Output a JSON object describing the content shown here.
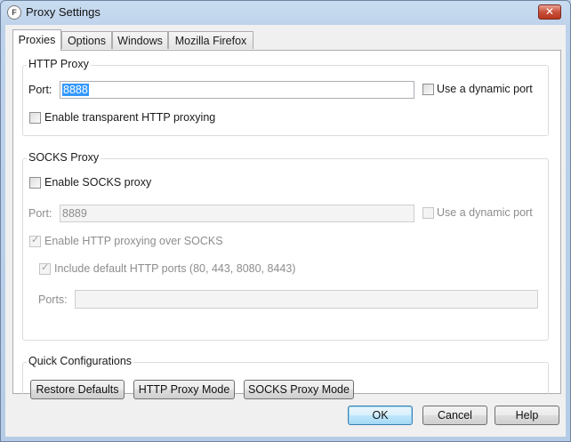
{
  "window": {
    "title": "Proxy Settings",
    "app_icon": "fiddler-icon",
    "close_glyph": "✕"
  },
  "tabs": [
    {
      "label": "Proxies"
    },
    {
      "label": "Options"
    },
    {
      "label": "Windows"
    },
    {
      "label": "Mozilla Firefox"
    }
  ],
  "http_proxy": {
    "title": "HTTP Proxy",
    "port_label": "Port:",
    "port_value": "8888",
    "dynamic_port_label": "Use a dynamic port",
    "transparent_label": "Enable transparent HTTP proxying"
  },
  "socks_proxy": {
    "title": "SOCKS Proxy",
    "enable_label": "Enable SOCKS proxy",
    "port_label": "Port:",
    "port_value": "8889",
    "dynamic_port_label": "Use a dynamic port",
    "http_over_socks_label": "Enable HTTP proxying over SOCKS",
    "include_ports_label": "Include default HTTP ports (80, 443, 8080, 8443)",
    "ports_label": "Ports:",
    "ports_value": ""
  },
  "quick": {
    "title": "Quick Configurations",
    "restore_label": "Restore Defaults",
    "http_mode_label": "HTTP Proxy Mode",
    "socks_mode_label": "SOCKS Proxy Mode"
  },
  "footer": {
    "ok_label": "OK",
    "cancel_label": "Cancel",
    "help_label": "Help"
  },
  "check_glyph": "✓"
}
